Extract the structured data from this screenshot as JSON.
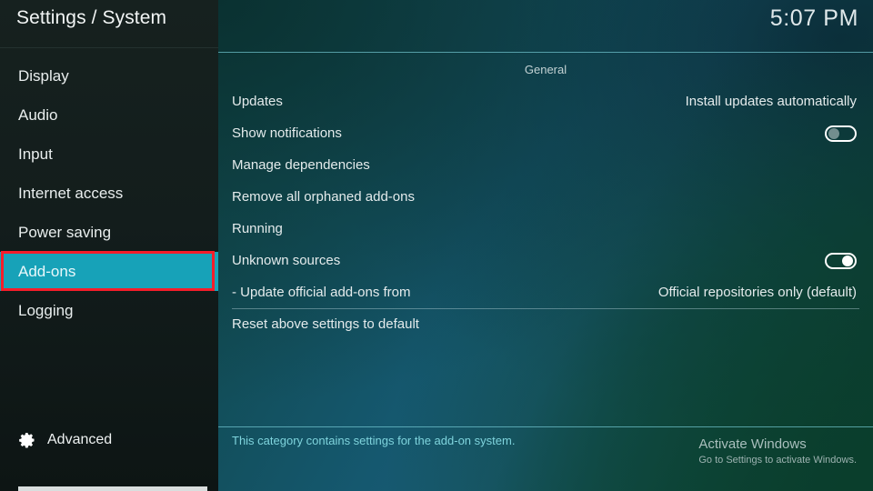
{
  "sidebar": {
    "title": "Settings / System",
    "items": [
      {
        "label": "Display",
        "selected": false
      },
      {
        "label": "Audio",
        "selected": false
      },
      {
        "label": "Input",
        "selected": false
      },
      {
        "label": "Internet access",
        "selected": false
      },
      {
        "label": "Power saving",
        "selected": false
      },
      {
        "label": "Add-ons",
        "selected": true
      },
      {
        "label": "Logging",
        "selected": false
      }
    ],
    "advanced": {
      "label": "Advanced",
      "icon": "gear-icon"
    },
    "selection_color": "#17a2b8",
    "annotation_color": "#f51d2a"
  },
  "header": {
    "clock": "5:07 PM"
  },
  "content": {
    "group_title": "General",
    "rows": [
      {
        "label": "Updates",
        "value": "Install updates automatically",
        "control": "text",
        "separator": false
      },
      {
        "label": "Show notifications",
        "value": "",
        "control": "toggle",
        "toggle_state": "off",
        "separator": false
      },
      {
        "label": "Manage dependencies",
        "value": "",
        "control": "none",
        "separator": false
      },
      {
        "label": "Remove all orphaned add-ons",
        "value": "",
        "control": "none",
        "separator": false
      },
      {
        "label": "Running",
        "value": "",
        "control": "none",
        "separator": false
      },
      {
        "label": "Unknown sources",
        "value": "",
        "control": "toggle",
        "toggle_state": "on",
        "separator": false
      },
      {
        "label": "- Update official add-ons from",
        "value": "Official repositories only (default)",
        "control": "text",
        "separator": false
      },
      {
        "label": "Reset above settings to default",
        "value": "",
        "control": "none",
        "separator": true
      }
    ],
    "description": "This category contains settings for the add-on system."
  },
  "watermark": {
    "title": "Activate Windows",
    "subtitle": "Go to Settings to activate Windows."
  }
}
